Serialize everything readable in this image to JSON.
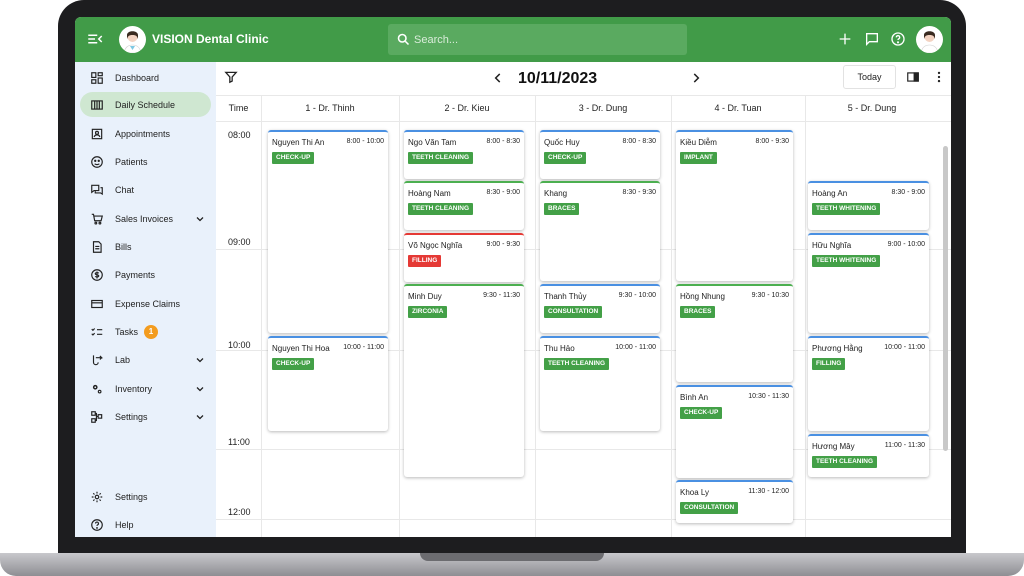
{
  "app": {
    "brand": "VISION Dental Clinic"
  },
  "search": {
    "placeholder": "Search..."
  },
  "sidebar": {
    "items": [
      {
        "label": "Dashboard"
      },
      {
        "label": "Daily Schedule"
      },
      {
        "label": "Appointments"
      },
      {
        "label": "Patients"
      },
      {
        "label": "Chat"
      },
      {
        "label": "Sales Invoices"
      },
      {
        "label": "Bills"
      },
      {
        "label": "Payments"
      },
      {
        "label": "Expense Claims"
      },
      {
        "label": "Tasks",
        "badge": "1"
      },
      {
        "label": "Lab"
      },
      {
        "label": "Inventory"
      },
      {
        "label": "Settings"
      }
    ],
    "footer": [
      {
        "label": "Settings"
      },
      {
        "label": "Help"
      }
    ]
  },
  "schedule": {
    "date": "10/11/2023",
    "today_label": "Today",
    "time_header": "Time",
    "columns": [
      "1 - Dr. Thinh",
      "2 - Dr. Kieu",
      "3 - Dr. Dung",
      "4 - Dr. Tuan",
      "5 - Dr. Dung"
    ],
    "times": [
      "08:00",
      "09:00",
      "10:00",
      "11:00",
      "12:00"
    ],
    "appointments": [
      {
        "name": "Nguyen Thi An",
        "time": "8:00 - 10:00",
        "tag": "CHECK-UP"
      },
      {
        "name": "Nguyen Thi Hoa",
        "time": "10:00 - 11:00",
        "tag": "CHECK-UP"
      },
      {
        "name": "Ngo Văn Tam",
        "time": "8:00 - 8:30",
        "tag": "TEETH CLEANING"
      },
      {
        "name": "Hoàng Nam",
        "time": "8:30 - 9:00",
        "tag": "TEETH CLEANING"
      },
      {
        "name": "Võ Ngọc Nghĩa",
        "time": "9:00 - 9:30",
        "tag": "FILLING"
      },
      {
        "name": "Minh Duy",
        "time": "9:30 - 11:30",
        "tag": "ZIRCONIA"
      },
      {
        "name": "Quốc Huy",
        "time": "8:00 - 8:30",
        "tag": "CHECK-UP"
      },
      {
        "name": "Khang",
        "time": "8:30 - 9:30",
        "tag": "BRACES"
      },
      {
        "name": "Thanh Thủy",
        "time": "9:30 - 10:00",
        "tag": "CONSULTATION"
      },
      {
        "name": "Thu Hảo",
        "time": "10:00 - 11:00",
        "tag": "TEETH CLEANING"
      },
      {
        "name": "Kiều Diễm",
        "time": "8:00 - 9:30",
        "tag": "IMPLANT"
      },
      {
        "name": "Hồng Nhung",
        "time": "9:30 - 10:30",
        "tag": "BRACES"
      },
      {
        "name": "Bình An",
        "time": "10:30 - 11:30",
        "tag": "CHECK-UP"
      },
      {
        "name": "Khoa Ly",
        "time": "11:30 - 12:00",
        "tag": "CONSULTATION"
      },
      {
        "name": "Hoàng An",
        "time": "8:30 - 9:00",
        "tag": "TEETH WHITENING"
      },
      {
        "name": "Hữu Nghĩa",
        "time": "9:00 - 10:00",
        "tag": "TEETH WHITENING"
      },
      {
        "name": "Phương Hằng",
        "time": "10:00 - 11:00",
        "tag": "FILLING"
      },
      {
        "name": "Hương Mây",
        "time": "11:00 - 11:30",
        "tag": "TEETH CLEANING"
      }
    ]
  },
  "colors": {
    "brand": "#419b48",
    "tag": "#43a047",
    "tag_alert": "#e53935",
    "badge": "#f39c1f",
    "active_nav": "#cfe7d1"
  }
}
